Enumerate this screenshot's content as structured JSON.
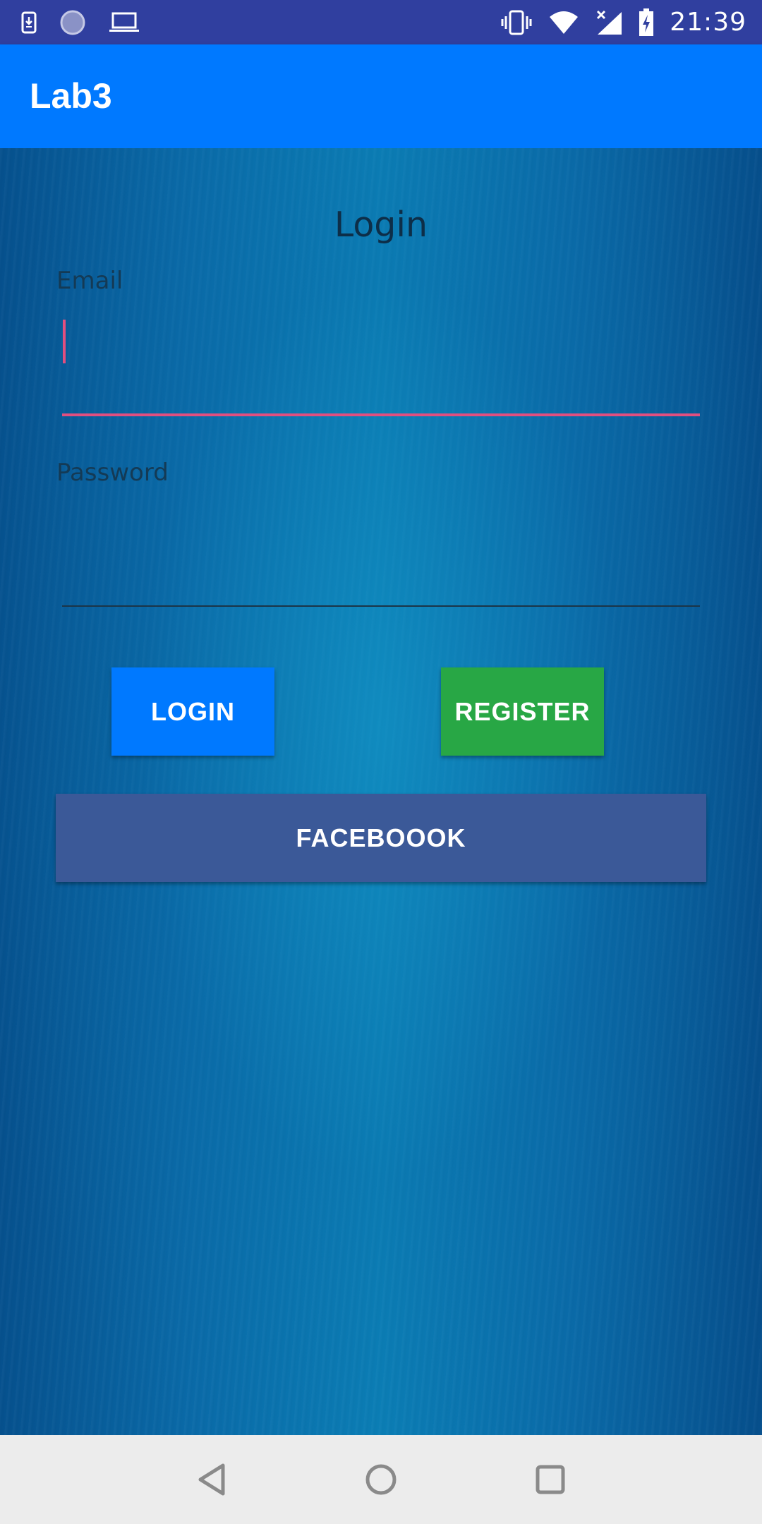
{
  "status_bar": {
    "time": "21:39",
    "left_icons": [
      "download-notification-icon",
      "sync-icon",
      "laptop-icon"
    ],
    "right_icons": [
      "vibrate-icon",
      "wifi-icon",
      "no-signal-icon",
      "battery-charging-icon"
    ]
  },
  "app_bar": {
    "title": "Lab3"
  },
  "form": {
    "title": "Login",
    "email_label": "Email",
    "email_value": "",
    "password_label": "Password",
    "password_value": ""
  },
  "buttons": {
    "login_label": "LOGIN",
    "register_label": "REGISTER",
    "facebook_label": "FACEBOOOK"
  },
  "colors": {
    "status_bar": "#303f9f",
    "app_bar": "#0079ff",
    "login_button": "#0079ff",
    "register_button": "#28a745",
    "facebook_button": "#3b5998",
    "email_underline_focused": "#e14f80"
  },
  "nav_bar": {
    "icons": [
      "back-icon",
      "home-icon",
      "recents-icon"
    ]
  }
}
